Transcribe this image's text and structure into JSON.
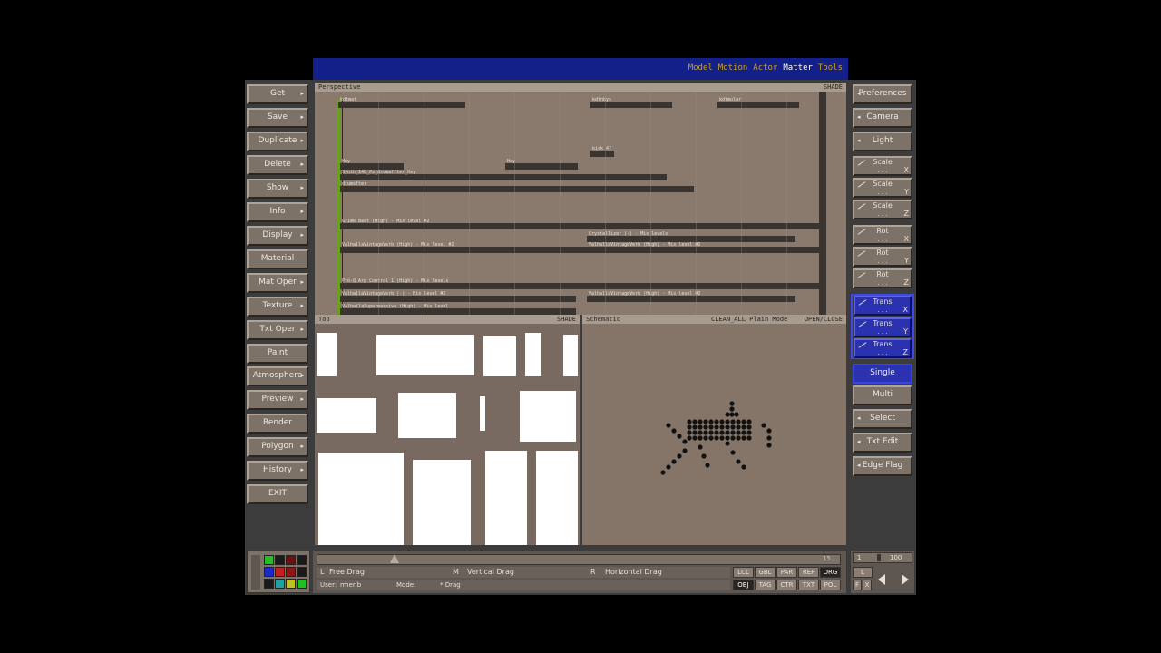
{
  "menu": {
    "modules": [
      "Model",
      "Motion",
      "Actor",
      "Matter",
      "Tools"
    ],
    "active": "Matter"
  },
  "left_buttons": [
    {
      "label": "Get",
      "arrow": true
    },
    {
      "label": "Save",
      "arrow": true
    },
    {
      "label": "Duplicate",
      "arrow": true
    },
    {
      "label": "Delete",
      "arrow": true
    },
    {
      "label": "Show",
      "arrow": true
    },
    {
      "label": "Info",
      "arrow": true
    },
    {
      "label": "Display",
      "arrow": true
    },
    {
      "label": "Material",
      "arrow": false
    },
    {
      "label": "Mat Oper",
      "arrow": true
    },
    {
      "label": "Texture",
      "arrow": true
    },
    {
      "label": "Txt Oper",
      "arrow": true
    },
    {
      "label": "Paint",
      "arrow": false
    },
    {
      "label": "Atmosphere",
      "arrow": true
    },
    {
      "label": "Preview",
      "arrow": true
    },
    {
      "label": "Render",
      "arrow": false
    },
    {
      "label": "Polygon",
      "arrow": true
    },
    {
      "label": "History",
      "arrow": true
    },
    {
      "label": "EXIT",
      "arrow": false
    }
  ],
  "right_buttons": {
    "preferences": "Preferences",
    "camera": "Camera",
    "light": "Light",
    "scale": [
      "Scale",
      "Scale",
      "Scale"
    ],
    "scale_axes": [
      "X",
      "Y",
      "Z"
    ],
    "rot": [
      "Rot",
      "Rot",
      "Rot"
    ],
    "rot_axes": [
      "X",
      "Y",
      "Z"
    ],
    "trans": [
      "Trans",
      "Trans",
      "Trans"
    ],
    "trans_axes": [
      "X",
      "Y",
      "Z"
    ],
    "single": "Single",
    "multi": "Multi",
    "select": "Select",
    "txt_edit": "Txt Edit",
    "edge_flag": "Edge Flag"
  },
  "viewports": {
    "perspective": {
      "name": "Perspective",
      "mode": "SHADE"
    },
    "top": {
      "name": "Top",
      "mode": "SHADE"
    },
    "schematic": {
      "name": "Schematic",
      "mode": "CLEAN_ALL  Plain Mode",
      "right": "OPEN/CLOSE"
    }
  },
  "tracks": [
    {
      "label": "kdtmat"
    },
    {
      "label": "kdtnbys"
    },
    {
      "label": "kdtmolar"
    },
    {
      "label": "kick 4?"
    },
    {
      "label": "Hey"
    },
    {
      "label": "Hey"
    },
    {
      "label": "Synth_140_Pz_drumaffter_Hey"
    },
    {
      "label": "drumsfter"
    },
    {
      "label": "Grime Beat (High) - Mix level #2"
    },
    {
      "label": "Crystallizer (-) - Mix levels"
    },
    {
      "label": "ValhallaVintageVerb (High) - Mix level #2"
    },
    {
      "label": "ValhallaVintageVerb (High) - Mix level #2"
    },
    {
      "label": "Pro-Q Arp Control 1 (High) - Mix levels"
    },
    {
      "label": "ValhallaVintageVerb (-) - Mix level #2"
    },
    {
      "label": "ValhallaVintageVerb (High) - Mix level #2"
    },
    {
      "label": "ValhallaSupermassive (High) - Mix level"
    }
  ],
  "timeline": {
    "frame": "15",
    "start": "1",
    "end": "100"
  },
  "mouse": {
    "left": "L",
    "left_action": "Free Drag",
    "middle": "M",
    "middle_action": "Vertical Drag",
    "right": "R",
    "right_action": "Horizontal Drag"
  },
  "status": {
    "user_label": "User:",
    "user": "rmerlb",
    "mode_label": "Mode:",
    "mode": "* Drag"
  },
  "toggles_row1": [
    "LCL",
    "GBL",
    "PAR",
    "REF",
    "DRG"
  ],
  "toggles_row2": [
    "OBJ",
    "TAG",
    "CTR",
    "TXT",
    "POL"
  ],
  "toggles_active": [
    "DRG",
    "OBJ"
  ],
  "right_bottom": {
    "f": "F",
    "x": "X",
    "l": "L"
  },
  "palette": [
    "#22c022",
    "#1a1a1a",
    "#6a1010",
    "#1a1a1a",
    "#1a28c8",
    "#c02020",
    "#8a1818",
    "#1a1a1a",
    "#1a1a1a",
    "#20a0a0",
    "#c0c020",
    "#20c020"
  ],
  "colors": {
    "menu_bg": "#14208a",
    "button": "#7d7268",
    "active_blue": "#2a32b0",
    "viewport_bg": "#8a7a6e"
  }
}
